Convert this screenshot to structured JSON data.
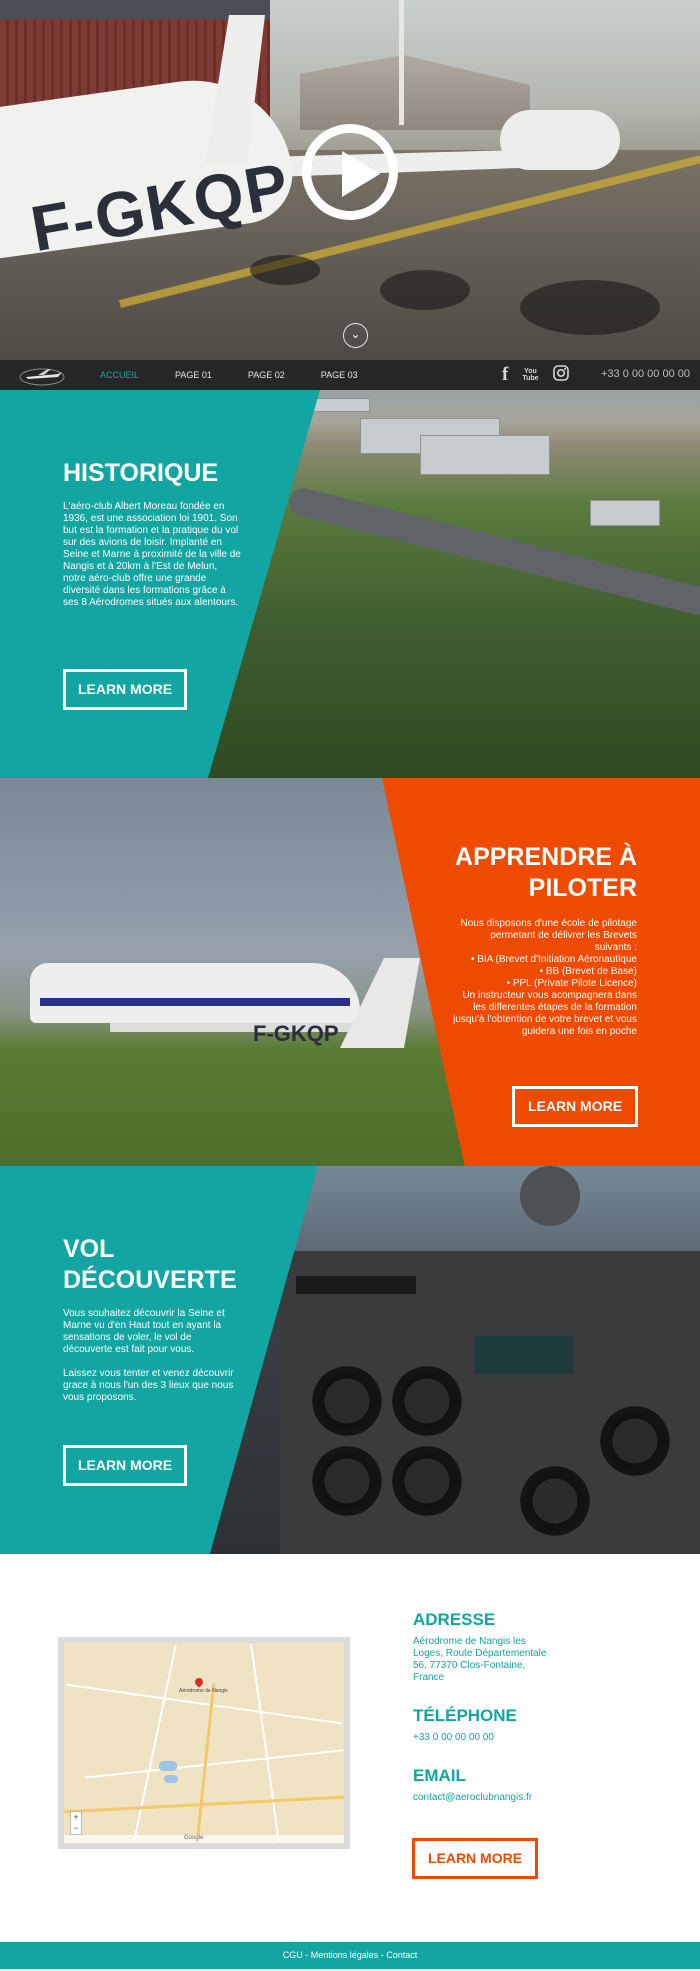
{
  "hero": {
    "plane_registration": "F-GKQP",
    "play_icon": "play-circle-icon",
    "scroll_icon": "chevron-down-icon"
  },
  "nav": {
    "logo_icon": "airplane-logo-icon",
    "items": [
      {
        "label": "ACCUEIL",
        "active": true
      },
      {
        "label": "PAGE 01",
        "active": false
      },
      {
        "label": "PAGE 02",
        "active": false
      },
      {
        "label": "PAGE 03",
        "active": false
      }
    ],
    "social": {
      "facebook": "f",
      "youtube_top": "You",
      "youtube_bottom": "Tube",
      "instagram": "instagram-icon"
    },
    "phone": "+33 0 00 00 00 00"
  },
  "historique": {
    "title": "HISTORIQUE",
    "text": "L'aéro-club Albert Moreau fondée en 1936, est une association loi 1901. Son but est la formation et la pratique du vol sur des avions de loisir. Implanté en Seine et Marne à proximité de la ville de Nangis et à 20km à l'Est de Melun, notre aéro-club offre une grande diversité dans les formations grâce à ses 8 Aérodromes situés aux alentours.",
    "button": "LEARN MORE"
  },
  "apprendre": {
    "title_line1": "APPRENDRE À",
    "title_line2": "PILOTER",
    "intro": "Nous disposons d'une école de pilotage permetant de délivrer les Brevets suivants :",
    "items": [
      "• BIA (Brevet d'Initiation Aéronautique",
      "• BB (Brevet de Base)",
      "• PPL (Private Pilote Licence)"
    ],
    "outro": "Un instructeur vous acompagnera dans les differentes étapes de la formation jusqu'à l'obtention de votre brevet et vous guidera une fois en poche",
    "plane_registration": "F-GKQP",
    "button": "LEARN MORE"
  },
  "decouverte": {
    "title_line1": "VOL",
    "title_line2": "DÉCOUVERTE",
    "text1": "Vous souhaitez découvrir la Seine et Marne vu d'en Haut tout en ayant la sensations de voler, le vol de découverte est fait pour vous.",
    "text2": "Laissez vous tenter et venez découvrir grace à nous l'un des 3 lieux que nous vous proposons.",
    "button": "LEARN MORE"
  },
  "contact": {
    "map": {
      "pin_label": "Aérodrome de Nangis",
      "zoom_in": "+",
      "zoom_out": "−",
      "google": "Google"
    },
    "address_title": "ADRESSE",
    "address": "Aérodrome de Nangis les Loges, Route Départementale 56, 77370 Clos-Fontaine, France",
    "phone_title": "TÉLÉPHONE",
    "phone": "+33 0 00 00 00 00",
    "email_title": "EMAIL",
    "email": "contact@aeroclubnangis.fr",
    "button": "LEARN MORE"
  },
  "footer": {
    "cgu": "CGU",
    "sep1": " - ",
    "mentions": "Mentions légales",
    "sep2": " - ",
    "contact": "Contact"
  },
  "colors": {
    "teal": "#13a5a2",
    "orange": "#ee4a00",
    "nav_bg": "#262626"
  }
}
